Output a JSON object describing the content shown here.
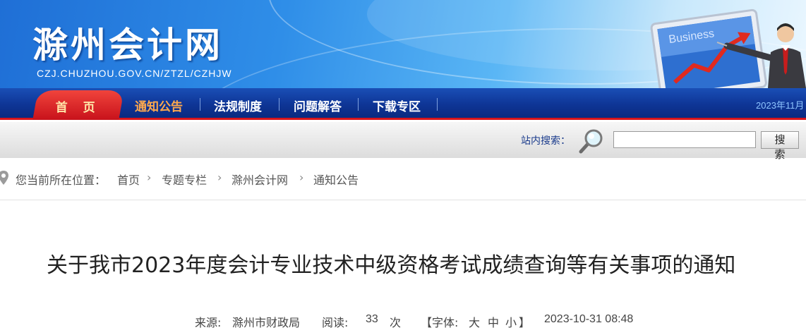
{
  "header": {
    "site_title": "滁州会计网",
    "site_url": "CZJ.CHUZHOU.GOV.CN/ZTZL/CZHJW",
    "deco_board_text": "Business"
  },
  "nav": {
    "home": "首 页",
    "items": [
      "通知公告",
      "法规制度",
      "问题解答",
      "下载专区"
    ],
    "active_index": 0,
    "date": "2023年11月"
  },
  "search": {
    "label": "站内搜索：",
    "value": "",
    "button": "搜 索"
  },
  "breadcrumb": {
    "prefix": "您当前所在位置：",
    "items": [
      "首页",
      "专题专栏",
      "滁州会计网",
      "通知公告"
    ]
  },
  "article": {
    "title": "关于我市2023年度会计专业技术中级资格考试成绩查询等有关事项的通知",
    "source_label": "来源:",
    "source": "滁州市财政局",
    "reads_label": "阅读:",
    "reads": "33",
    "reads_unit": "次",
    "font_label": "【字体:",
    "font_large": "大",
    "font_medium": "中",
    "font_small": "小",
    "font_close": "】",
    "date": "2023-10-31 08:48"
  },
  "colors": {
    "nav_blue": "#0e3596",
    "accent_red": "#d7151b",
    "active_orange": "#ffa94d"
  }
}
